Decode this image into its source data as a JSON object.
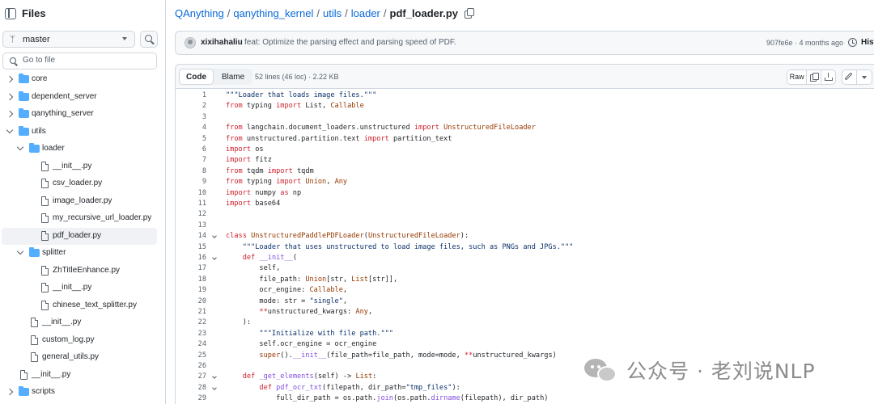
{
  "sidebar": {
    "title": "Files",
    "branch": "master",
    "goto_placeholder": "Go to file",
    "tree": [
      {
        "name": "core",
        "type": "folder",
        "depth": 0,
        "open": false
      },
      {
        "name": "dependent_server",
        "type": "folder",
        "depth": 0,
        "open": false
      },
      {
        "name": "qanything_server",
        "type": "folder",
        "depth": 0,
        "open": false
      },
      {
        "name": "utils",
        "type": "folder",
        "depth": 0,
        "open": true
      },
      {
        "name": "loader",
        "type": "folder",
        "depth": 1,
        "open": true
      },
      {
        "name": "__init__.py",
        "type": "file",
        "depth": 2
      },
      {
        "name": "csv_loader.py",
        "type": "file",
        "depth": 2
      },
      {
        "name": "image_loader.py",
        "type": "file",
        "depth": 2
      },
      {
        "name": "my_recursive_url_loader.py",
        "type": "file",
        "depth": 2
      },
      {
        "name": "pdf_loader.py",
        "type": "file",
        "depth": 2,
        "selected": true
      },
      {
        "name": "splitter",
        "type": "folder",
        "depth": 1,
        "open": true
      },
      {
        "name": "ZhTitleEnhance.py",
        "type": "file",
        "depth": 2
      },
      {
        "name": "__init__.py",
        "type": "file",
        "depth": 2
      },
      {
        "name": "chinese_text_splitter.py",
        "type": "file",
        "depth": 2
      },
      {
        "name": "__init__.py",
        "type": "file",
        "depth": 1
      },
      {
        "name": "custom_log.py",
        "type": "file",
        "depth": 1
      },
      {
        "name": "general_utils.py",
        "type": "file",
        "depth": 1
      },
      {
        "name": "__init__.py",
        "type": "file",
        "depth": 0
      },
      {
        "name": "scripts",
        "type": "folder",
        "depth": 0,
        "open": false
      }
    ]
  },
  "breadcrumb": {
    "parts": [
      "QAnything",
      "qanything_kernel",
      "utils",
      "loader"
    ],
    "current": "pdf_loader.py"
  },
  "commit": {
    "author": "xixihahaliu",
    "message": "feat: Optimize the parsing effect and parsing speed of PDF.",
    "meta": "907fe6e · 4 months ago",
    "history": "Histo"
  },
  "code_toolbar": {
    "code_tab": "Code",
    "blame_tab": "Blame",
    "stats": "52 lines (46 loc) · 2.22 KB",
    "raw": "Raw"
  },
  "code": [
    {
      "n": "1",
      "t": [
        [
          "s",
          "\"\"\"Loader that loads image files.\"\"\""
        ]
      ]
    },
    {
      "n": "2",
      "t": [
        [
          "k",
          "from"
        ],
        [
          "",
          " typing "
        ],
        [
          "k",
          "import"
        ],
        [
          "",
          " List, "
        ],
        [
          "c",
          "Callable"
        ]
      ]
    },
    {
      "n": "3",
      "t": []
    },
    {
      "n": "4",
      "t": [
        [
          "k",
          "from"
        ],
        [
          "",
          " langchain.document_loaders.unstructured "
        ],
        [
          "k",
          "import"
        ],
        [
          "",
          " "
        ],
        [
          "c",
          "UnstructuredFileLoader"
        ]
      ]
    },
    {
      "n": "5",
      "t": [
        [
          "k",
          "from"
        ],
        [
          "",
          " unstructured.partition.text "
        ],
        [
          "k",
          "import"
        ],
        [
          "",
          " partition_text"
        ]
      ]
    },
    {
      "n": "6",
      "t": [
        [
          "k",
          "import"
        ],
        [
          "",
          " os"
        ]
      ]
    },
    {
      "n": "7",
      "t": [
        [
          "k",
          "import"
        ],
        [
          "",
          " fitz"
        ]
      ]
    },
    {
      "n": "8",
      "t": [
        [
          "k",
          "from"
        ],
        [
          "",
          " tqdm "
        ],
        [
          "k",
          "import"
        ],
        [
          "",
          " tqdm"
        ]
      ]
    },
    {
      "n": "9",
      "t": [
        [
          "k",
          "from"
        ],
        [
          "",
          " typing "
        ],
        [
          "k",
          "import"
        ],
        [
          "",
          " "
        ],
        [
          "c",
          "Union"
        ],
        [
          "",
          ", "
        ],
        [
          "c",
          "Any"
        ]
      ]
    },
    {
      "n": "10",
      "t": [
        [
          "k",
          "import"
        ],
        [
          "",
          " numpy "
        ],
        [
          "k",
          "as"
        ],
        [
          "",
          " np"
        ]
      ]
    },
    {
      "n": "11",
      "t": [
        [
          "k",
          "import"
        ],
        [
          "",
          " base64"
        ]
      ]
    },
    {
      "n": "12",
      "t": []
    },
    {
      "n": "13",
      "t": []
    },
    {
      "n": "14",
      "fold": true,
      "t": [
        [
          "k",
          "class"
        ],
        [
          "",
          " "
        ],
        [
          "c",
          "UnstructuredPaddlePDFLoader"
        ],
        [
          "",
          "("
        ],
        [
          "c",
          "UnstructuredFileLoader"
        ],
        [
          "",
          "):"
        ]
      ]
    },
    {
      "n": "15",
      "t": [
        [
          "",
          "    "
        ],
        [
          "s",
          "\"\"\"Loader that uses unstructured to load image files, such as PNGs and JPGs.\"\"\""
        ]
      ]
    },
    {
      "n": "16",
      "fold": true,
      "t": [
        [
          "",
          "    "
        ],
        [
          "k",
          "def"
        ],
        [
          "",
          " "
        ],
        [
          "f",
          "__init__"
        ],
        [
          "",
          "("
        ]
      ]
    },
    {
      "n": "17",
      "t": [
        [
          "",
          "        self,"
        ]
      ]
    },
    {
      "n": "18",
      "t": [
        [
          "",
          "        file_path: "
        ],
        [
          "c",
          "Union"
        ],
        [
          "",
          "[str, "
        ],
        [
          "c",
          "List"
        ],
        [
          "",
          "[str]],"
        ]
      ]
    },
    {
      "n": "19",
      "t": [
        [
          "",
          "        ocr_engine: "
        ],
        [
          "c",
          "Callable"
        ],
        [
          "",
          ","
        ]
      ]
    },
    {
      "n": "20",
      "t": [
        [
          "",
          "        mode: str = "
        ],
        [
          "s",
          "\"single\""
        ],
        [
          "",
          ","
        ]
      ]
    },
    {
      "n": "21",
      "t": [
        [
          "",
          "        "
        ],
        [
          "k",
          "**"
        ],
        [
          "",
          "unstructured_kwargs: "
        ],
        [
          "c",
          "Any"
        ],
        [
          "",
          ","
        ]
      ]
    },
    {
      "n": "22",
      "t": [
        [
          "",
          "    ):"
        ]
      ]
    },
    {
      "n": "23",
      "t": [
        [
          "",
          "        "
        ],
        [
          "s",
          "\"\"\"Initialize with file path.\"\"\""
        ]
      ]
    },
    {
      "n": "24",
      "t": [
        [
          "",
          "        self.ocr_engine = ocr_engine"
        ]
      ]
    },
    {
      "n": "25",
      "t": [
        [
          "",
          "        "
        ],
        [
          "c",
          "super"
        ],
        [
          "",
          "()."
        ],
        [
          "f",
          "__init__"
        ],
        [
          "",
          "(file_path=file_path, mode=mode, "
        ],
        [
          "k",
          "**"
        ],
        [
          "",
          "unstructured_kwargs)"
        ]
      ]
    },
    {
      "n": "26",
      "t": []
    },
    {
      "n": "27",
      "fold": true,
      "t": [
        [
          "",
          "    "
        ],
        [
          "k",
          "def"
        ],
        [
          "",
          " "
        ],
        [
          "f",
          "_get_elements"
        ],
        [
          "",
          "(self) -> "
        ],
        [
          "c",
          "List"
        ],
        [
          "",
          ":"
        ]
      ]
    },
    {
      "n": "28",
      "fold": true,
      "t": [
        [
          "",
          "        "
        ],
        [
          "k",
          "def"
        ],
        [
          "",
          " "
        ],
        [
          "f",
          "pdf_ocr_txt"
        ],
        [
          "",
          "(filepath, dir_path="
        ],
        [
          "s",
          "\"tmp_files\""
        ],
        [
          "",
          "):"
        ]
      ]
    },
    {
      "n": "29",
      "t": [
        [
          "",
          "            full_dir_path = os.path."
        ],
        [
          "f",
          "join"
        ],
        [
          "",
          "(os.path."
        ],
        [
          "f",
          "dirname"
        ],
        [
          "",
          "(filepath), dir_path)"
        ]
      ]
    }
  ],
  "watermark": "公众号 · 老刘说NLP"
}
